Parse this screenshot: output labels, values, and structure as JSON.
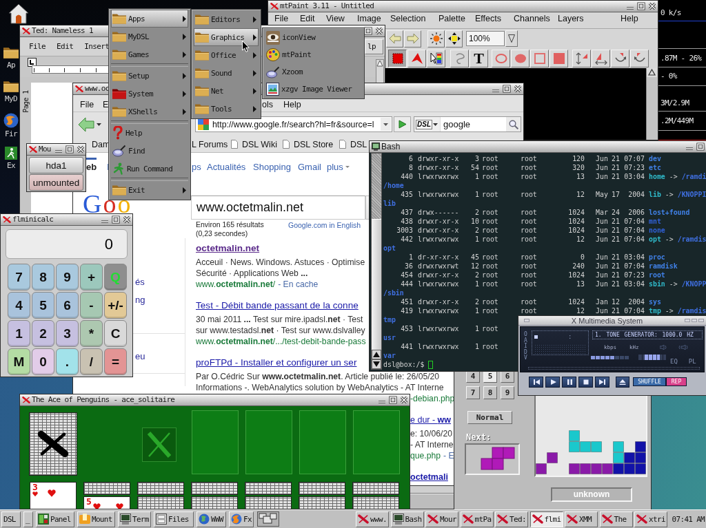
{
  "desktop": {
    "icons": [
      {
        "label": "Ap",
        "kind": "folder"
      },
      {
        "label": "MyD",
        "kind": "folder"
      },
      {
        "label": "Fir",
        "kind": "globe"
      },
      {
        "label": "Ex",
        "kind": "runner"
      }
    ]
  },
  "system_monitor": {
    "readings": [
      "0 k/s",
      ".87M - 26%",
      "- 0%",
      "3M/2.9M",
      ".2M/449M"
    ]
  },
  "mtpaint_window": {
    "title": "mtPaint 3.11 - Untitled",
    "menu": [
      "File",
      "Edit",
      "View",
      "Image",
      "Selection",
      "Palette",
      "Effects",
      "Channels",
      "Layers",
      "Help"
    ],
    "zoom": "100%",
    "toolbar": [
      {
        "kind": "back"
      },
      {
        "kind": "forward"
      },
      {
        "kind": "sun"
      },
      {
        "kind": "move"
      }
    ],
    "tools": [
      {
        "kind": "rect-select",
        "selected": true
      },
      {
        "kind": "polygon-select",
        "selected": false
      },
      {
        "kind": "picker",
        "selected": false
      },
      {
        "kind": "lasso",
        "selected": false
      },
      {
        "kind": "text",
        "label": "T",
        "selected": false
      },
      {
        "kind": "ellipse",
        "selected": false
      },
      {
        "kind": "filled-ellipse",
        "selected": false
      },
      {
        "kind": "rectangle",
        "selected": false
      },
      {
        "kind": "filled-rectangle",
        "selected": false
      },
      {
        "kind": "flip-vertical",
        "selected": false
      },
      {
        "kind": "flip-horizontal",
        "selected": false
      },
      {
        "kind": "rotate-right",
        "selected": false
      },
      {
        "kind": "rotate-left",
        "selected": false
      }
    ]
  },
  "ted_window": {
    "title": "Ted: Nameless 1",
    "menu": [
      "File",
      "Edit",
      "Insert"
    ],
    "menu_end": "lp",
    "page_label": "Page 1"
  },
  "browser_window": {
    "title": "www.oc",
    "menu": [
      "File",
      "E",
      "ols",
      "Help"
    ],
    "url": "http://www.google.fr/search?hl=fr&source=l",
    "search_engine": "DSL",
    "search_text": "google",
    "bookmarks": [
      {
        "label": "Dam",
        "icon": false
      },
      {
        "label": "L Forums",
        "icon": false
      },
      {
        "label": "DSL Wiki",
        "icon": true
      },
      {
        "label": "DSL Store",
        "icon": true
      },
      {
        "label": "DSL",
        "icon": true
      }
    ],
    "google_nav": [
      {
        "label": "eb",
        "selected": true
      },
      {
        "label": "I",
        "selected": false
      },
      {
        "label": "ps",
        "selected": false
      },
      {
        "label": "Actualités",
        "selected": false
      },
      {
        "label": "Shopping",
        "selected": false
      },
      {
        "label": "Gmail",
        "selected": false
      },
      {
        "label": "plus",
        "selected": false
      }
    ],
    "logo": "Goo",
    "sidebar": [
      "és",
      "ng",
      "eu"
    ],
    "query": "www.octetmalin.net",
    "stats": [
      "Environ 165 résultats",
      "(0,23 secondes)"
    ],
    "language_link": "Google.com in English",
    "results": [
      {
        "title": "octetmalin.net",
        "visited": true,
        "bold": true,
        "lines": [
          "Acceuil · News. Windows. Astuces · Optimise",
          "Sécurité · Applications Web **...**"
        ],
        "url": "www.**octetmalin.net**/",
        "cache": "- En cache"
      },
      {
        "title": "Test - Débit bande passant de la conne",
        "visited": false,
        "bold": false,
        "lines": [
          "30 mai 2011 **...** Test sur mire.ipadsl.**net** · Test",
          "sur www.testadsl.**net** · Test sur www.dslvalley"
        ],
        "url": "www.**octetmalin.net**/.../test-debit-bande-pass"
      },
      {
        "title": "proFTPd - Installer et configurer un ser",
        "visited": false,
        "bold": false,
        "lines": [
          "Par O.Cédric Sur **www.octetmalin.net**. Article publié le: 26/05/20",
          "Informations -. WebAnalytics solution by WebAnalytics - AT Interne"
        ]
      }
    ],
    "more": [
      {
        "kind": "url",
        "text": "-debian.php"
      },
      {
        "kind": "title",
        "text": "e dur - **ww**",
        "bold": false
      },
      {
        "kind": "text",
        "text": "e: 10/06/20"
      },
      {
        "kind": "text",
        "text": "- AT Interne"
      },
      {
        "kind": "url",
        "text": "que.php",
        "cache": "- E"
      },
      {
        "kind": "title",
        "text": "octetmali",
        "bold": true
      }
    ]
  },
  "mount_window": {
    "title": "Mou",
    "device": "hda1",
    "status": "unmounted"
  },
  "calculator": {
    "title": "flminicalc",
    "display": "0",
    "keys": [
      {
        "label": "7",
        "kind": "key",
        "color": "#a9c9de"
      },
      {
        "label": "8",
        "kind": "key",
        "color": "#a9c9de"
      },
      {
        "label": "9",
        "kind": "key",
        "color": "#a9c9de"
      },
      {
        "label": "+",
        "kind": "key",
        "color": "#9cc8bc"
      },
      {
        "label": "Q",
        "kind": "quit",
        "color": "#8e8e8e"
      },
      {
        "label": "4",
        "kind": "key",
        "color": "#a9c3dc"
      },
      {
        "label": "5",
        "kind": "key",
        "color": "#a9c3dc"
      },
      {
        "label": "6",
        "kind": "key",
        "color": "#a9c3dc"
      },
      {
        "label": "-",
        "kind": "key",
        "color": "#a6c8b2"
      },
      {
        "label": "+/-",
        "kind": "key",
        "color": "#e2c996"
      },
      {
        "label": "1",
        "kind": "key",
        "color": "#c6c0e0"
      },
      {
        "label": "2",
        "kind": "key",
        "color": "#c6c0e0"
      },
      {
        "label": "3",
        "kind": "key",
        "color": "#c6c0e0"
      },
      {
        "label": "*",
        "kind": "key",
        "color": "#adc8b0"
      },
      {
        "label": "C",
        "kind": "key",
        "color": "#d9d9d9"
      },
      {
        "label": "M",
        "kind": "key",
        "color": "#b4dca4"
      },
      {
        "label": "0",
        "kind": "key",
        "color": "#e2cce8"
      },
      {
        "label": ".",
        "kind": "key",
        "color": "#a2e2ea"
      },
      {
        "label": "/",
        "kind": "key",
        "color": "#c9c2b2"
      },
      {
        "label": "=",
        "kind": "key",
        "color": "#e39494"
      }
    ]
  },
  "terminal": {
    "title": "Bash",
    "lines": [
      {
        "kind": "entry",
        "inode": "6",
        "perms": "drwxr-xr-x",
        "links": "3",
        "owner": "root",
        "group": "root",
        "size": "120",
        "month": "Jun",
        "day": "21",
        "time": "07:07",
        "name": "dev",
        "color": "#4080e6"
      },
      {
        "kind": "entry",
        "inode": "8",
        "perms": "drwxr-xr-x",
        "links": "54",
        "owner": "root",
        "group": "root",
        "size": "320",
        "month": "Jun",
        "day": "21",
        "time": "07:23",
        "name": "etc",
        "color": "#4080e6"
      },
      {
        "kind": "entry",
        "inode": "440",
        "perms": "lrwxrwxrwx",
        "links": "1",
        "owner": "root",
        "group": "root",
        "size": "13",
        "month": "Jun",
        "day": "21",
        "time": "03:04",
        "name": "home",
        "color": "#2fb8c8",
        "arrow": "->",
        "target": "/ramdi"
      },
      {
        "kind": "wrap",
        "text": "/home"
      },
      {
        "kind": "entry",
        "inode": "435",
        "perms": "lrwxrwxrwx",
        "links": "1",
        "owner": "root",
        "group": "root",
        "size": "12",
        "month": "May",
        "day": "17",
        "time": "2004",
        "name": "lib",
        "color": "#2fb8c8",
        "arrow": "->",
        "target": "/KNOPPI"
      },
      {
        "kind": "wrap",
        "text": "lib"
      },
      {
        "kind": "entry",
        "inode": "437",
        "perms": "drwx------",
        "links": "2",
        "owner": "root",
        "group": "root",
        "size": "1024",
        "month": "Mar",
        "day": "24",
        "time": "2006",
        "name": "lost+found",
        "color": "#4080e6"
      },
      {
        "kind": "entry",
        "inode": "438",
        "perms": "drwxr-xr-x",
        "links": "10",
        "owner": "root",
        "group": "root",
        "size": "1024",
        "month": "Jun",
        "day": "21",
        "time": "07:04",
        "name": "mnt",
        "color": "#3060d8"
      },
      {
        "kind": "entry",
        "inode": "3003",
        "perms": "drwxr-xr-x",
        "links": "2",
        "owner": "root",
        "group": "root",
        "size": "1024",
        "month": "Jun",
        "day": "21",
        "time": "07:04",
        "name": "none",
        "color": "#3060d8"
      },
      {
        "kind": "entry",
        "inode": "442",
        "perms": "lrwxrwxrwx",
        "links": "1",
        "owner": "root",
        "group": "root",
        "size": "12",
        "month": "Jun",
        "day": "21",
        "time": "07:04",
        "name": "opt",
        "color": "#2fb8c8",
        "arrow": "->",
        "target": "/ramdis"
      },
      {
        "kind": "wrap",
        "text": "opt"
      },
      {
        "kind": "entry",
        "inode": "1",
        "perms": "dr-xr-xr-x",
        "links": "45",
        "owner": "root",
        "group": "root",
        "size": "0",
        "month": "Jun",
        "day": "21",
        "time": "03:04",
        "name": "proc",
        "color": "#4080e6"
      },
      {
        "kind": "entry",
        "inode": "36",
        "perms": "drwxrwxrwt",
        "links": "12",
        "owner": "root",
        "group": "root",
        "size": "240",
        "month": "Jun",
        "day": "21",
        "time": "07:04",
        "name": "ramdisk",
        "color": "#4080e6"
      },
      {
        "kind": "entry",
        "inode": "454",
        "perms": "drwxr-xr-x",
        "links": "2",
        "owner": "root",
        "group": "root",
        "size": "1024",
        "month": "Jun",
        "day": "21",
        "time": "07:23",
        "name": "root",
        "color": "#4080e6"
      },
      {
        "kind": "entry",
        "inode": "444",
        "perms": "lrwxrwxrwx",
        "links": "1",
        "owner": "root",
        "group": "root",
        "size": "13",
        "month": "Jun",
        "day": "21",
        "time": "03:04",
        "name": "sbin",
        "color": "#2fb8c8",
        "arrow": "->",
        "target": "/KNOPP"
      },
      {
        "kind": "wrap",
        "text": "/sbin"
      },
      {
        "kind": "entry",
        "inode": "451",
        "perms": "drwxr-xr-x",
        "links": "2",
        "owner": "root",
        "group": "root",
        "size": "1024",
        "month": "Jan",
        "day": "12",
        "time": "2004",
        "name": "sys",
        "color": "#4080e6"
      },
      {
        "kind": "entry",
        "inode": "419",
        "perms": "lrwxrwxrwx",
        "links": "1",
        "owner": "root",
        "group": "root",
        "size": "12",
        "month": "Jun",
        "day": "21",
        "time": "07:04",
        "name": "tmp",
        "color": "#2fb8c8",
        "arrow": "->",
        "target": "/ramdis"
      },
      {
        "kind": "wrap",
        "text": "tmp"
      },
      {
        "kind": "entry",
        "inode": "453",
        "perms": "lrwxrwxrwx",
        "links": "1",
        "owner": "root"
      },
      {
        "kind": "wrap",
        "text": "usr"
      },
      {
        "kind": "entry",
        "inode": "441",
        "perms": "lrwxrwxrwx",
        "links": "1",
        "owner": "root"
      },
      {
        "kind": "wrap",
        "text": "var"
      }
    ],
    "prompt": "dsl@box:/$"
  },
  "xmms": {
    "title": "X Multimedia System",
    "clutterbar": "OAIDV",
    "time_separator": ":",
    "song": "1. TONE GENERATOR: 1000.0 HZ",
    "bitrate_unit": "kbps",
    "rate_unit": "kHz",
    "volume": {
      "level": 0.62
    },
    "balance": {
      "level": 0.5
    },
    "toggles": [
      {
        "label": "EQ",
        "on": false
      },
      {
        "label": "PL",
        "on": false
      }
    ],
    "controls": [
      {
        "kind": "previous"
      },
      {
        "kind": "play"
      },
      {
        "kind": "pause"
      },
      {
        "kind": "stop"
      },
      {
        "kind": "next"
      },
      {
        "kind": "eject"
      }
    ],
    "shuffle": {
      "label": "SHUFFLE",
      "on": false
    },
    "repeat": {
      "label": "REP",
      "on": true
    }
  },
  "tetris": {
    "keypad": [
      {
        "label": "4",
        "selected": false
      },
      {
        "label": "5",
        "selected": true
      },
      {
        "label": "6",
        "selected": false
      },
      {
        "label": "7",
        "selected": false
      },
      {
        "label": "8",
        "selected": false
      },
      {
        "label": "9",
        "selected": false
      }
    ],
    "level_button": "Normal",
    "next_label": "Next:",
    "status": "unknown"
  },
  "solitaire": {
    "title": "The Ace of Penguins - ace_solitaire",
    "tableau": [
      {
        "kind": "face",
        "rank": "3"
      },
      {
        "kind": "back-over-face",
        "rank": "5"
      },
      {
        "kind": "back"
      },
      {
        "kind": "back"
      },
      {
        "kind": "back"
      },
      {
        "kind": "back"
      },
      {
        "kind": "back"
      }
    ]
  },
  "menus": {
    "main": [
      {
        "kind": "folder",
        "label": "Apps",
        "submenu": true,
        "selected": true
      },
      {
        "kind": "folder",
        "label": "MyDSL",
        "submenu": true,
        "selected": false
      },
      {
        "kind": "folder",
        "label": "Games",
        "submenu": true,
        "selected": false
      },
      {
        "kind": "separator"
      },
      {
        "kind": "folder",
        "label": "Setup",
        "submenu": true,
        "selected": false
      },
      {
        "kind": "system-folder",
        "label": "System",
        "submenu": true,
        "selected": false
      },
      {
        "kind": "folder",
        "label": "XShells",
        "submenu": true,
        "selected": false
      },
      {
        "kind": "separator"
      },
      {
        "kind": "help",
        "label": "Help",
        "submenu": false,
        "selected": false
      },
      {
        "kind": "dish",
        "label": "Find",
        "submenu": false,
        "selected": false
      },
      {
        "kind": "run",
        "label": "Run Command",
        "submenu": false,
        "selected": false
      },
      {
        "kind": "separator"
      },
      {
        "kind": "folder",
        "label": "Exit",
        "submenu": true,
        "selected": false
      }
    ],
    "apps": [
      {
        "kind": "folder",
        "label": "Editors",
        "submenu": true,
        "selected": false
      },
      {
        "kind": "folder",
        "label": "Graphics",
        "submenu": true,
        "selected": true
      },
      {
        "kind": "folder",
        "label": "Office",
        "submenu": true,
        "selected": false
      },
      {
        "kind": "folder",
        "label": "Sound",
        "submenu": true,
        "selected": false
      },
      {
        "kind": "folder",
        "label": "Net",
        "submenu": true,
        "selected": false
      },
      {
        "kind": "folder",
        "label": "Tools",
        "submenu": true,
        "selected": false
      }
    ],
    "graphics": [
      {
        "kind": "eye",
        "label": "iconView",
        "submenu": false,
        "selected": false
      },
      {
        "kind": "palette",
        "label": "mtPaint",
        "submenu": false,
        "selected": false
      },
      {
        "kind": "dish",
        "label": "Xzoom",
        "submenu": false,
        "selected": false
      },
      {
        "kind": "picture",
        "label": "xzgv Image Viewer",
        "submenu": false,
        "selected": false
      }
    ]
  },
  "taskbar": {
    "start": "DSL",
    "launchers": [
      {
        "label": "_",
        "kind": "plain"
      },
      {
        "label": "Panel",
        "kind": "panel"
      },
      {
        "label": "Mount",
        "kind": "mount"
      },
      {
        "label": "Term",
        "kind": "term"
      },
      {
        "label": "Files",
        "kind": "files"
      },
      {
        "label": "WWW",
        "kind": "globe"
      },
      {
        "label": "Fx",
        "kind": "firefox"
      }
    ],
    "tasks": [
      {
        "label": "www.",
        "kind": "x",
        "selected": false
      },
      {
        "label": "Bash",
        "kind": "term",
        "selected": false
      },
      {
        "label": "Mour",
        "kind": "x",
        "selected": false
      },
      {
        "label": "mtPa",
        "kind": "x",
        "selected": false
      },
      {
        "label": "Ted:",
        "kind": "x",
        "selected": false
      },
      {
        "label": "flmi",
        "kind": "x",
        "selected": true
      },
      {
        "label": "XMM",
        "kind": "x",
        "selected": false
      },
      {
        "label": "The",
        "kind": "x",
        "selected": false
      },
      {
        "label": "xtri",
        "kind": "x",
        "selected": false
      }
    ],
    "clock": "07:41 AM"
  }
}
